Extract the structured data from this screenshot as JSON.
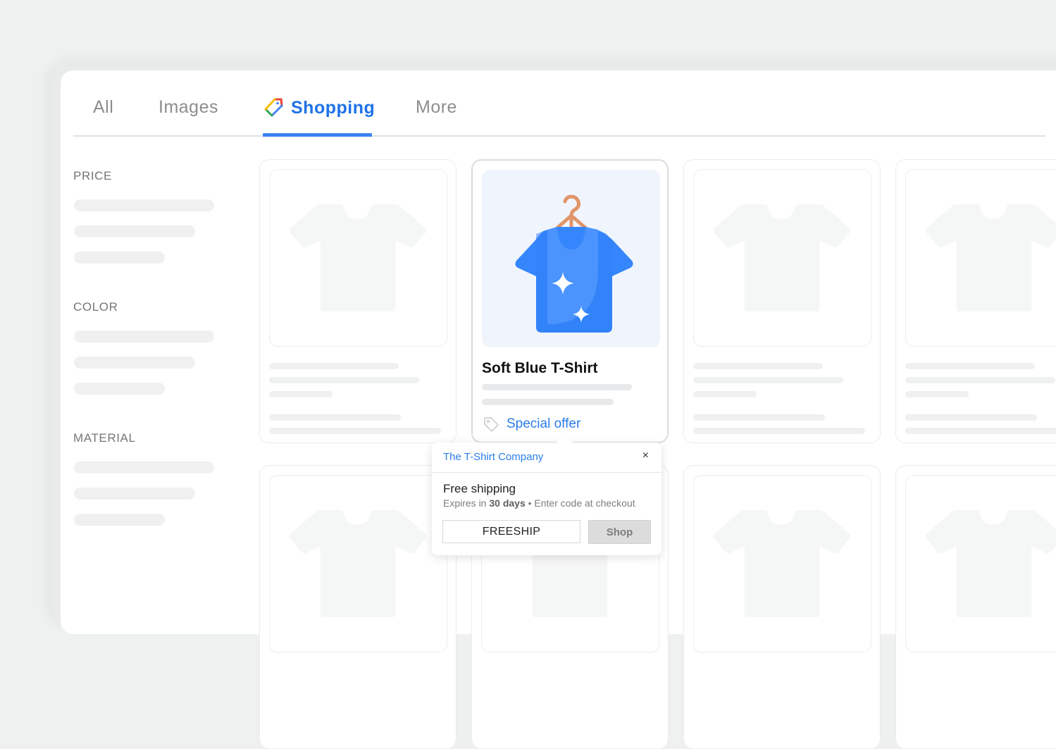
{
  "tabs": [
    {
      "label": "All",
      "active": false
    },
    {
      "label": "Images",
      "active": false
    },
    {
      "label": "Shopping",
      "active": true,
      "icon": "shopping-tag-icon"
    },
    {
      "label": "More",
      "active": false
    }
  ],
  "colors": {
    "accent": "#1f73e8",
    "link": "#2a7de8",
    "shirt": "#3586fd",
    "hanger": "#e0956a",
    "skeleton": "#f0f0f0"
  },
  "filters": [
    {
      "title": "PRICE"
    },
    {
      "title": "COLOR"
    },
    {
      "title": "MATERIAL"
    }
  ],
  "featured_product": {
    "title": "Soft Blue T-Shirt",
    "offer_label": "Special offer",
    "offer_icon": "tag-icon"
  },
  "popover": {
    "merchant": "The T-Shirt Company",
    "close_label": "×",
    "offer_title": "Free shipping",
    "expires_prefix": "Expires in ",
    "expires_value": "30 days",
    "expires_suffix": " • Enter code at checkout",
    "promo_code": "FREESHIP",
    "shop_label": "Shop"
  }
}
